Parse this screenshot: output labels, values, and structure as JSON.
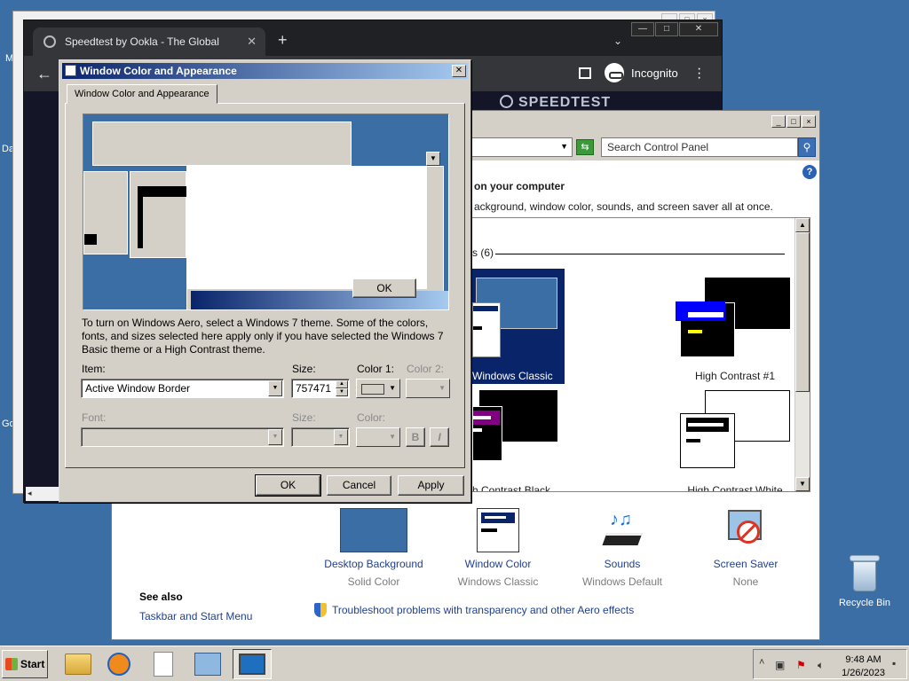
{
  "desktop": {
    "side_labels": [
      "M",
      "Da",
      "Go"
    ],
    "recycle_bin": "Recycle Bin"
  },
  "chrome": {
    "tab_title": "Speedtest by Ookla - The Global",
    "incognito": "Incognito",
    "speedtest_logo": "SPEEDTEST"
  },
  "control_panel": {
    "search_placeholder": "Search Control Panel",
    "heading": "on your computer",
    "subheading": "ackground, window color, sounds, and screen saver all at once.",
    "group_label": "s (6)",
    "themes": [
      {
        "label": "Windows Classic",
        "selected": true
      },
      {
        "label": "High Contrast #1",
        "selected": false
      },
      {
        "label": "h Contrast Black",
        "selected": false
      },
      {
        "label": "High Contrast White",
        "selected": false
      }
    ],
    "tools": [
      {
        "name": "Desktop Background",
        "value": "Solid Color",
        "icon": "desktop-background-icon"
      },
      {
        "name": "Window Color",
        "value": "Windows Classic",
        "icon": "window-color-icon"
      },
      {
        "name": "Sounds",
        "value": "Windows Default",
        "icon": "sounds-icon"
      },
      {
        "name": "Screen Saver",
        "value": "None",
        "icon": "screen-saver-icon"
      }
    ],
    "see_also": "See also",
    "see_also_link": "Taskbar and Start Menu",
    "troubleshoot": "Troubleshoot problems with transparency and other Aero effects"
  },
  "dialog": {
    "title": "Window Color and Appearance",
    "tab": "Window Color and Appearance",
    "preview_ok": "OK",
    "description": "To turn on Windows Aero, select a Windows 7 theme.  Some of the colors, fonts, and sizes selected here apply only if you have selected the Windows 7 Basic theme or a High Contrast theme.",
    "item_label": "Item:",
    "item_value": "Active Window Border",
    "size_label": "Size:",
    "size_value": "757471",
    "color1_label": "Color 1:",
    "color2_label": "Color 2:",
    "font_label": "Font:",
    "font_size_label": "Size:",
    "font_color_label": "Color:",
    "bold_label": "B",
    "italic_label": "I",
    "ok": "OK",
    "cancel": "Cancel",
    "apply": "Apply"
  },
  "taskbar": {
    "start": "Start",
    "time": "9:48 AM",
    "date": "1/26/2023"
  },
  "colors": {
    "desktop": "#3a6ea5",
    "chrome_dark": "#202124",
    "selection": "#0a246a",
    "link": "#1f3f8f"
  }
}
